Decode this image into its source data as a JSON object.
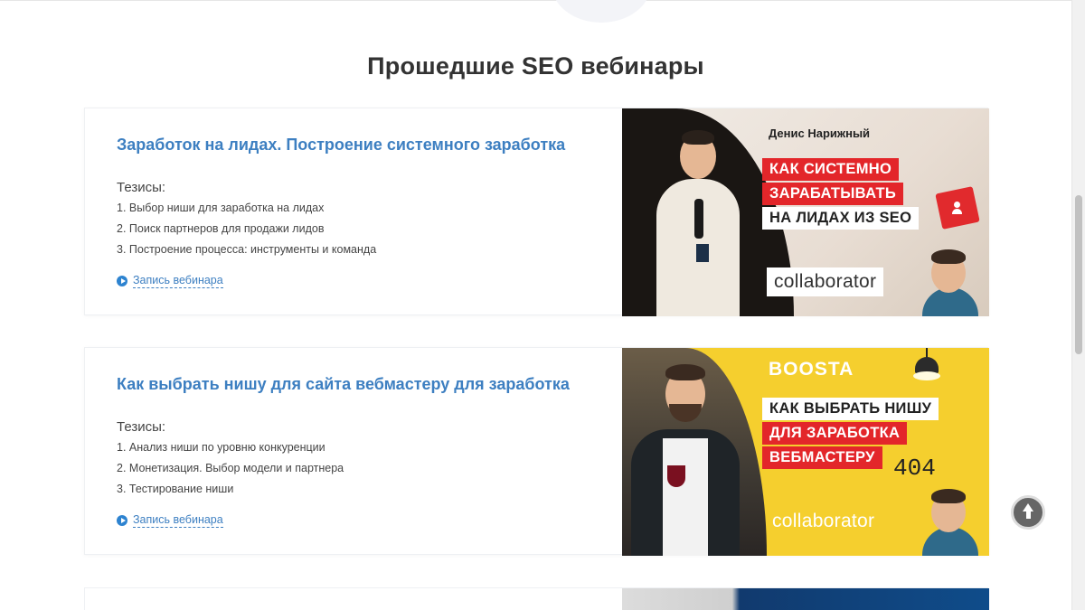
{
  "section": {
    "title": "Прошедшие SEO вебинары"
  },
  "webinars": [
    {
      "title": "Заработок на лидах. Построение системного заработка",
      "theses_label": "Тезисы:",
      "theses": [
        "1. Выбор ниши для заработка на лидах",
        "2. Поиск партнеров для продажи лидов",
        "3. Построение процесса: инструменты и команда"
      ],
      "record_link": "Запись вебинара",
      "banner": {
        "speaker": "Денис Нарижный",
        "lines": [
          "КАК СИСТЕМНО",
          "ЗАРАБАТЫВАТЬ",
          "НА ЛИДАХ ИЗ SEO"
        ],
        "logo": "collaborator"
      }
    },
    {
      "title": "Как выбрать нишу для сайта вебмастеру для заработка",
      "theses_label": "Тезисы:",
      "theses": [
        "1. Анализ ниши по уровню конкуренции",
        "2. Монетизация. Выбор модели и партнера",
        "3. Тестирование ниши"
      ],
      "record_link": "Запись вебинара",
      "banner": {
        "brand": "BOOSTA",
        "lines": [
          "КАК ВЫБРАТЬ НИШУ",
          "ДЛЯ ЗАРАБОТКА",
          "ВЕБМАСТЕРУ"
        ],
        "code": "404",
        "logo": "collaborator"
      }
    }
  ],
  "colors": {
    "link": "#3d7fc1",
    "banner_red": "#e3262a",
    "banner_yellow": "#f5cf2e"
  }
}
